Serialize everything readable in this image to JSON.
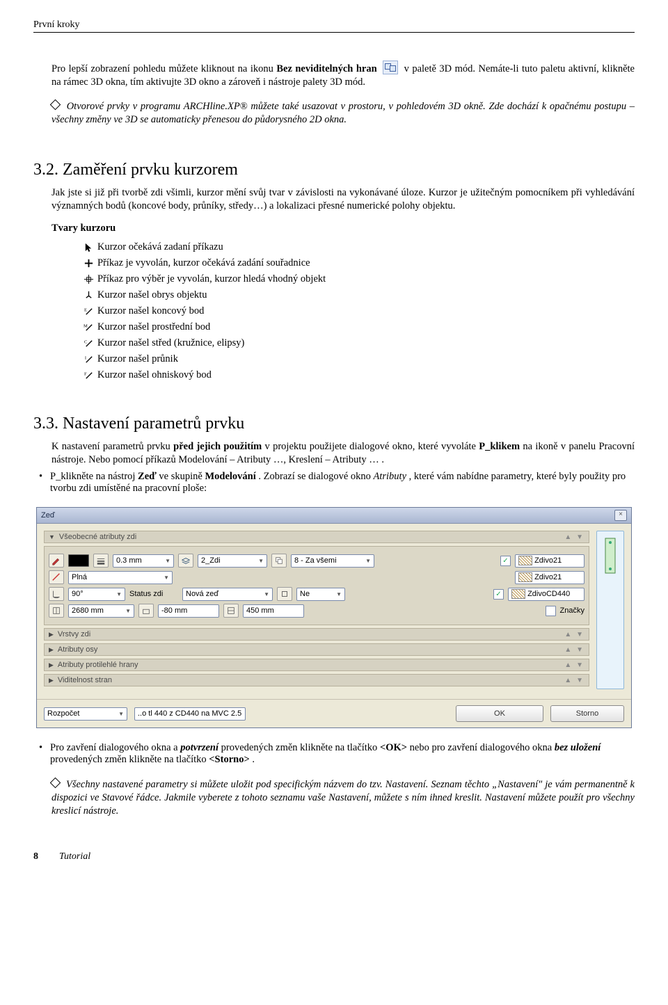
{
  "header": {
    "title": "První kroky"
  },
  "para1": {
    "p1a": "Pro lepší zobrazení pohledu můžete kliknout na ikonu ",
    "p1b_bold": "Bez neviditelných hran",
    "p1c": " v paletě 3D mód. Nemáte-li tuto paletu aktivní, klikněte na rámec 3D okna, tím aktivujte 3D okno a zároveň i nástroje palety 3D mód."
  },
  "note1": {
    "line1": "Otvorové prvky v programu ARCHline.XP® můžete také usazovat v prostoru, v pohledovém 3D okně. Zde dochází k opačnému postupu – všechny změny ve 3D se automaticky přenesou do půdorysného 2D okna."
  },
  "sec32": {
    "num": "3.2.",
    "title": "Zaměření prvku kurzorem",
    "intro": "Jak jste si již při tvorbě zdi všimli, kurzor mění svůj tvar v závislosti na vykonávané úloze. Kurzor je užitečným pomocníkem při vyhledávání významných bodů (koncové body, průníky, středy…) a lokalizaci přesné numerické polohy objektu.",
    "sub": "Tvary kurzoru",
    "cursors": [
      "Kurzor očekává zadaní příkazu",
      "Příkaz je vyvolán, kurzor očekává zadání souřadnice",
      "Příkaz pro výběr je vyvolán, kurzor hledá vhodný objekt",
      "Kurzor našel obrys objektu",
      "Kurzor našel koncový bod",
      "Kurzor našel prostřední bod",
      "Kurzor našel střed (kružnice, elipsy)",
      "Kurzor našel průnik",
      "Kurzor našel ohniskový bod"
    ]
  },
  "sec33": {
    "num": "3.3.",
    "title": "Nastavení parametrů prvku",
    "intro_a": "K nastavení parametrů prvku ",
    "intro_b_bold": "před jejich použitím",
    "intro_c": " v projektu použijete dialogové okno, které vyvoláte ",
    "intro_d_bold": "P_klikem",
    "intro_e": " na ikoně v panelu Pracovní nástroje. Nebo pomocí příkazů Modelování – Atributy …, Kreslení – Atributy … .",
    "li2_a": "P_klikněte na nástroj ",
    "li2_b_bold": "Zeď",
    "li2_c": " ve skupině ",
    "li2_d_bold": "Modelování",
    "li2_e": ". Zobrazí se dialogové okno ",
    "li2_f_it": "Atributy",
    "li2_g": ", které vám nabídne parametry, které byly použity pro tvorbu zdi umístěné na pracovní ploše:"
  },
  "dlg": {
    "title": "Zeď",
    "panel_open": "Všeobecné atributy zdi",
    "panels_closed": [
      "Vrstvy zdi",
      "Atributy osy",
      "Atributy protilehlé hrany",
      "Viditelnost stran"
    ],
    "r1": {
      "thickness": "0.3 mm",
      "layer": "2_Zdi",
      "order": "8 - Za všemi",
      "mat1": "Zdivo21"
    },
    "r2": {
      "linetype": "Plná",
      "mat2": "Zdivo21"
    },
    "r3": {
      "angle": "90°",
      "status_label": "Status zdi",
      "status": "Nová zeď",
      "ne": "Ne",
      "mat3": "ZdivoCD440"
    },
    "r4": {
      "h1": "2680 mm",
      "h2": "-80 mm",
      "h3": "450 mm",
      "tags": "Značky"
    },
    "footer": {
      "budget": "Rozpočet",
      "note": "..o tl 440 z CD440 na MVC 2.5",
      "ok": "OK",
      "storno": "Storno"
    }
  },
  "after": {
    "b1_a": "Pro zavření dialogového okna a ",
    "b1_b_it": "potvrzení",
    "b1_c": " provedených změn klikněte na tlačítko ",
    "b1_d_bold": "<OK>",
    "b1_e": " nebo pro zavření dialogového okna ",
    "b1_f_it": "bez uložení",
    "b1_g": " provedených změn klikněte na tlačítko ",
    "b1_h_bold": "<Storno>",
    "b1_i": "."
  },
  "note2": "Všechny nastavené parametry si můžete uložit pod specifickým názvem do tzv. Nastavení. Seznam těchto „Nastavení\" je vám permanentně k dispozici ve Stavové řádce. Jakmile vyberete z tohoto seznamu vaše Nastavení, můžete s ním ihned kreslit. Nastavení můžete použít pro všechny kreslicí nástroje.",
  "footer_page": {
    "num": "8",
    "label": "Tutorial"
  }
}
